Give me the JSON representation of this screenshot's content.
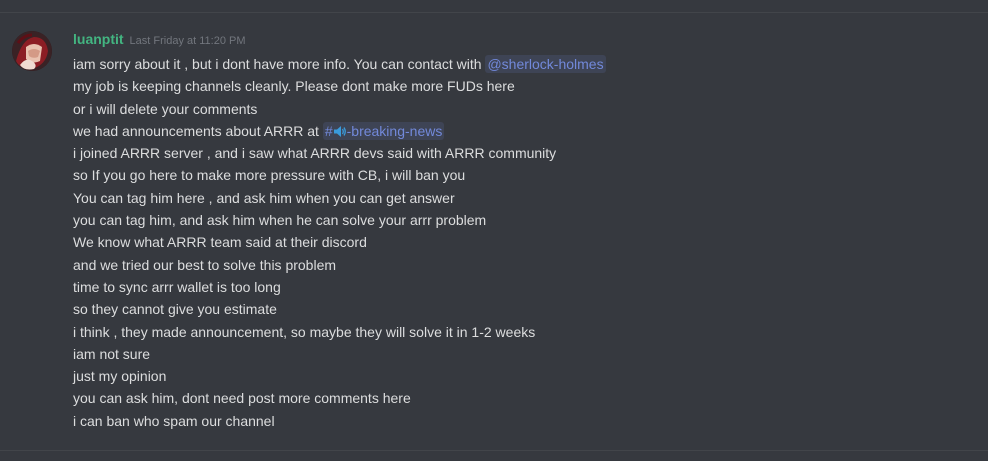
{
  "message": {
    "username": "luanptit",
    "timestamp": "Last Friday at 11:20 PM",
    "colors": {
      "username": "#43b581",
      "mention": "#7289da",
      "text": "#dcddde",
      "timestamp": "#72767d",
      "background": "#36393f"
    },
    "line1": {
      "text": "iam sorry about it , but i dont have more info. You can contact with ",
      "mention": "@sherlock-holmes"
    },
    "line2": "my job is keeping channels cleanly. Please dont make more FUDs here",
    "line3": "or i will delete your comments",
    "line4": {
      "text": "we had announcements about ARRR at ",
      "channel_hash": "#",
      "channel_icon": "speaker-icon",
      "channel_name": "-breaking-news"
    },
    "line5": "i joined ARRR server , and i saw what ARRR devs said with ARRR community",
    "line6": "so If you go here to make more pressure with CB, i will ban you",
    "line7": "You can tag him here , and ask him when you can get answer",
    "line8": "you can tag him, and ask him when he can solve your arrr problem",
    "line9": "We know what ARRR team said at their discord",
    "line10": "and we tried our best to solve this problem",
    "line11": "time to sync arrr wallet is too long",
    "line12": "so they cannot give you estimate",
    "line13": "i think , they made announcement, so maybe they will solve it in 1-2 weeks",
    "line14": "iam not sure",
    "line15": "just my opinion",
    "line16": "you can ask him, dont need post more comments here",
    "line17": "i can ban who spam our channel"
  }
}
